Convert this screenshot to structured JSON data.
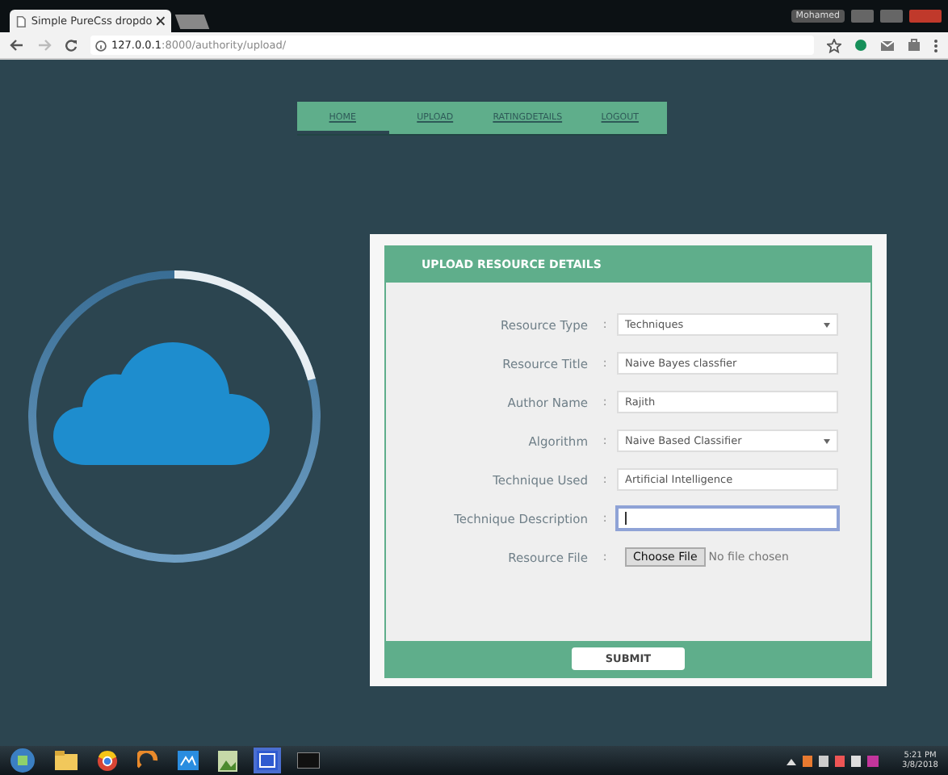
{
  "browser": {
    "tab_title": "Simple PureCss dropdo",
    "user": "Mohamed",
    "url_host": "127.0.0.1",
    "url_path": ":8000/authority/upload/"
  },
  "nav": [
    {
      "label": "HOME",
      "selected": true
    },
    {
      "label": "UPLOAD",
      "selected": false
    },
    {
      "label": "RATINGDETAILS",
      "selected": false
    },
    {
      "label": "LOGOUT",
      "selected": false
    }
  ],
  "form": {
    "title": "UPLOAD RESOURCE DETAILS",
    "fields": [
      {
        "label": "Resource Type",
        "separator": ":",
        "kind": "select",
        "value": "Techniques",
        "focused": false
      },
      {
        "label": "Resource Title",
        "separator": ":",
        "kind": "text",
        "value": "Naive Bayes classfier",
        "focused": false
      },
      {
        "label": "Author Name",
        "separator": ":",
        "kind": "text",
        "value": "Rajith",
        "focused": false
      },
      {
        "label": "Algorithm",
        "separator": ":",
        "kind": "select",
        "value": "Naive Based Classifier",
        "focused": false
      },
      {
        "label": "Technique Used",
        "separator": ":",
        "kind": "text",
        "value": "Artificial Intelligence",
        "focused": false
      },
      {
        "label": "Technique Description",
        "separator": ":",
        "kind": "text",
        "focused": true
      },
      {
        "label": "Resource File",
        "separator": ":",
        "kind": "file",
        "button": "Choose File",
        "value": "No file chosen",
        "focused": false
      }
    ],
    "submit": "SUBMIT"
  },
  "taskbar": {
    "time": "5:21 PM",
    "date": "3/8/2018"
  }
}
